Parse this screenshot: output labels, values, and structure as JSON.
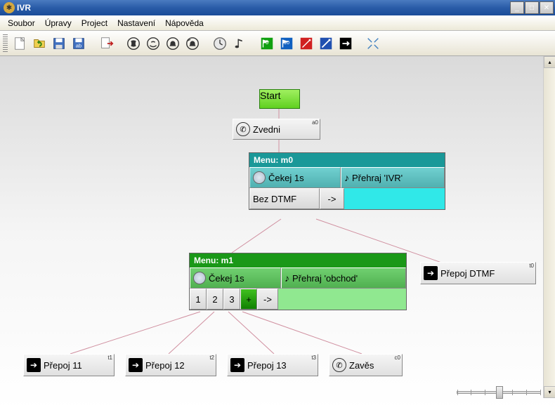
{
  "title": "IVR",
  "menu": {
    "items": [
      "Soubor",
      "Úpravy",
      "Project",
      "Nastavení",
      "Nápověda"
    ]
  },
  "toolbar": {
    "icons": [
      "new",
      "open",
      "save",
      "save-as",
      "export",
      "call",
      "call-ring",
      "bell",
      "bell-ring",
      "clock",
      "note",
      "flag-green",
      "flag-blue",
      "flag-red",
      "arrow-out",
      "arrow-right",
      "crosshair"
    ]
  },
  "nodes": {
    "start": {
      "label": "Start"
    },
    "zvedni": {
      "label": "Zvedni",
      "corner": "a0"
    },
    "prepoj_dtmf": {
      "label": "Přepoj DTMF",
      "corner": "t0"
    },
    "prepoj_11": {
      "label": "Přepoj 11",
      "corner": "t1"
    },
    "prepoj_12": {
      "label": "Přepoj 12",
      "corner": "t2"
    },
    "prepoj_13": {
      "label": "Přepoj 13",
      "corner": "t3"
    },
    "zaves": {
      "label": "Zavěs",
      "corner": "c0"
    }
  },
  "menus": {
    "m0": {
      "title": "Menu: m0",
      "cekej": "Čekej 1s",
      "prehraj": "Přehraj 'IVR'",
      "bez_dtmf": "Bez DTMF",
      "arrow": "->"
    },
    "m1": {
      "title": "Menu: m1",
      "cekej": "Čekej 1s",
      "prehraj": "Přehraj 'obchod'",
      "opts": [
        "1",
        "2",
        "3",
        "+",
        "->"
      ]
    }
  },
  "flags": {
    "green": "0",
    "blue": "10"
  }
}
